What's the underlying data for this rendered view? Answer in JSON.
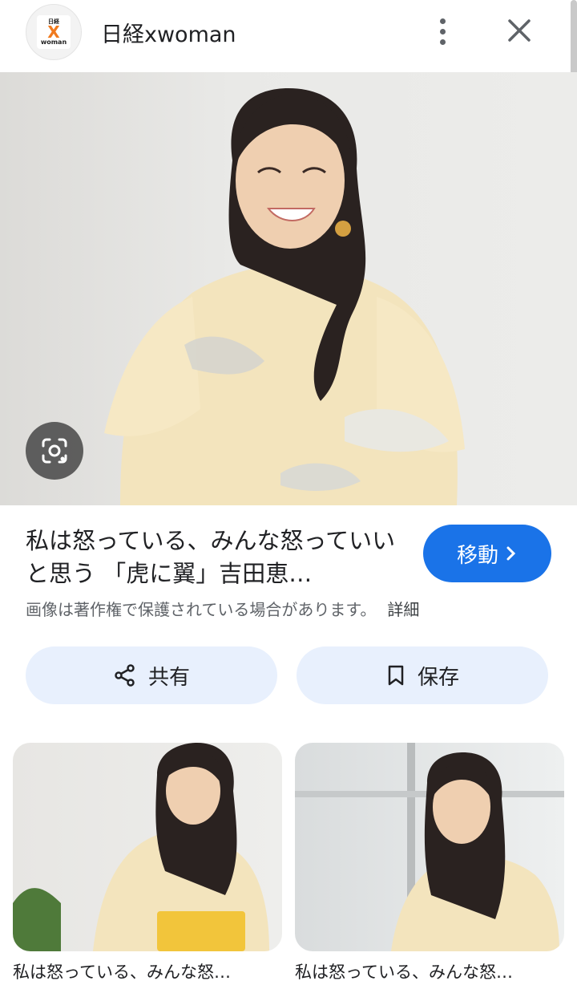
{
  "header": {
    "logo_top": "日経",
    "logo_mark": "X",
    "logo_bottom": "woman",
    "site_name": "日経xwoman"
  },
  "result": {
    "title": "私は怒っている、みんな怒っていいと思う 「虎に翼」吉田恵…",
    "go_label": "移動",
    "copyright": "画像は著作権で保護されている場合があります。",
    "detail_label": "詳細",
    "share_label": "共有",
    "save_label": "保存"
  },
  "related": [
    {
      "title": "私は怒っている、みんな怒…"
    },
    {
      "title": "私は怒っている、みんな怒…"
    }
  ]
}
